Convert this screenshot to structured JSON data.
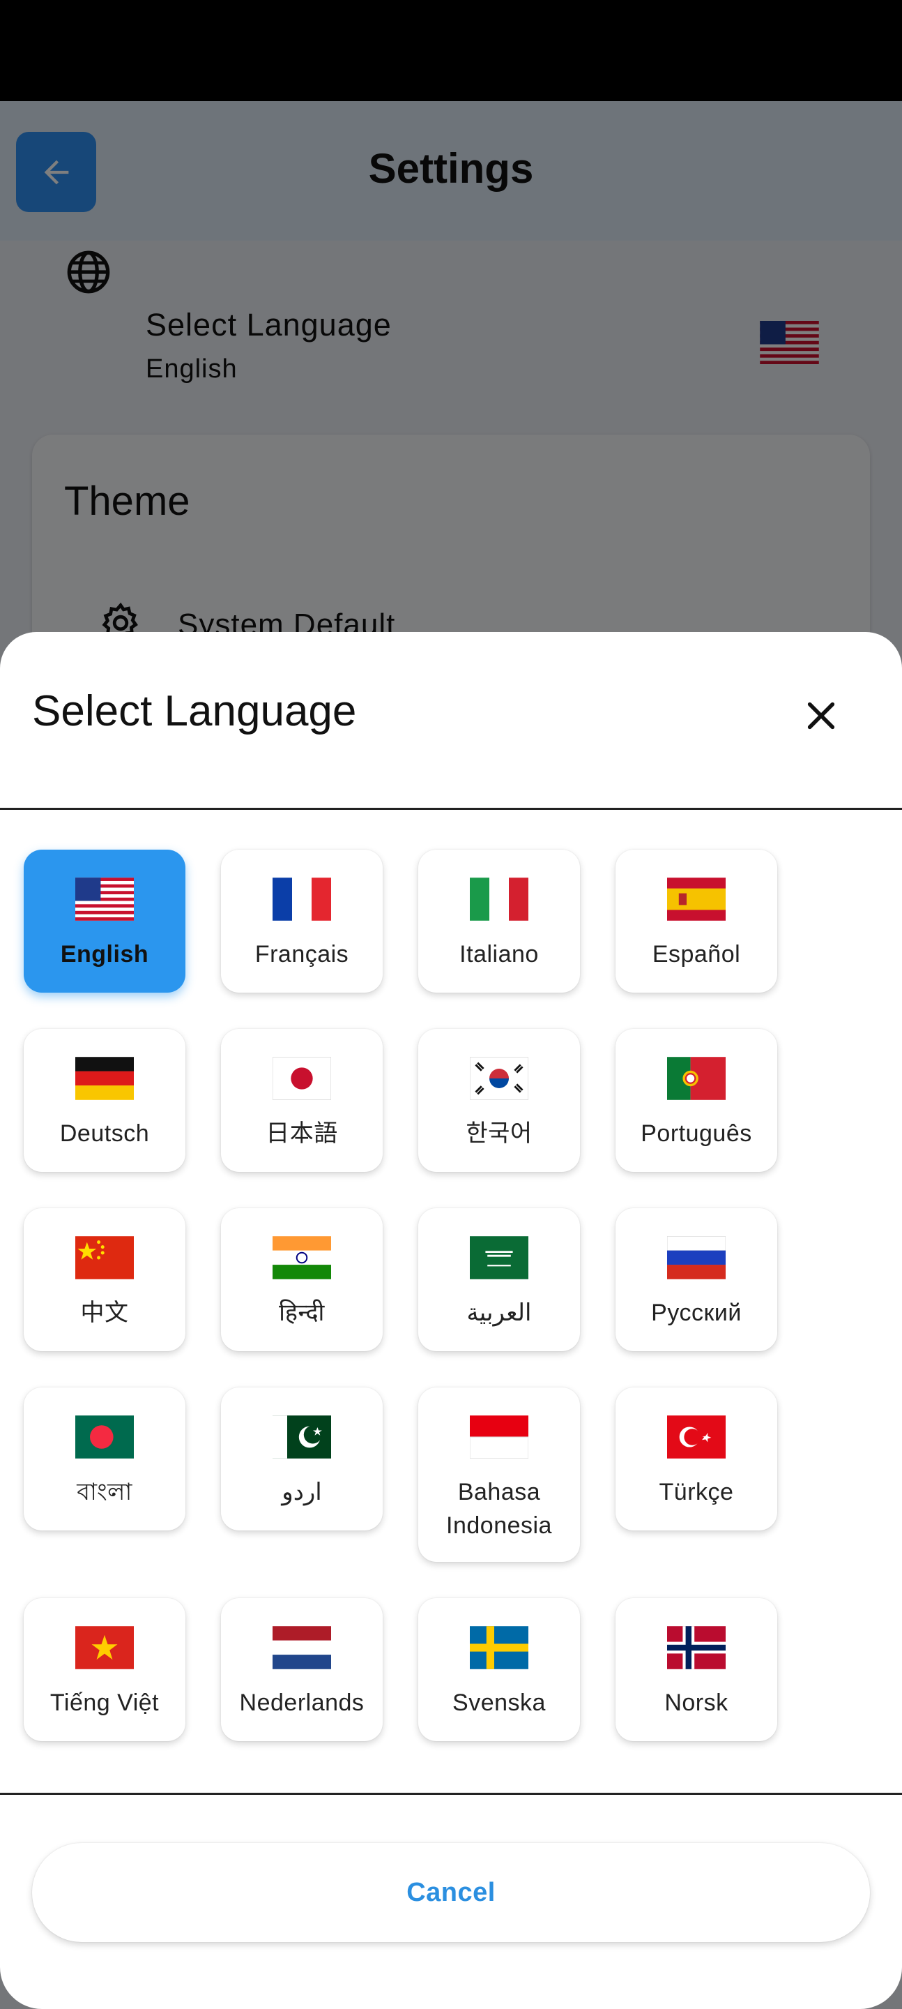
{
  "screen": {
    "title": "Settings",
    "language_setting": {
      "title": "Select Language",
      "value": "English",
      "flag_icon": "us-flag"
    },
    "theme": {
      "title": "Theme",
      "option": "System Default"
    }
  },
  "dialog": {
    "title": "Select Language",
    "cancel_label": "Cancel",
    "accent_color": "#2b96ee",
    "languages": [
      {
        "label": "English",
        "flag": "us-flag",
        "selected": true
      },
      {
        "label": "Français",
        "flag": "france-flag"
      },
      {
        "label": "Italiano",
        "flag": "italy-flag"
      },
      {
        "label": "Español",
        "flag": "spain-flag"
      },
      {
        "label": "Deutsch",
        "flag": "germany-flag"
      },
      {
        "label": "日本語",
        "flag": "japan-flag"
      },
      {
        "label": "한국어",
        "flag": "korea-flag"
      },
      {
        "label": "Português",
        "flag": "portugal-flag"
      },
      {
        "label": "中文",
        "flag": "china-flag"
      },
      {
        "label": "हिन्दी",
        "flag": "india-flag"
      },
      {
        "label": "العربية",
        "flag": "saudi-arabia-flag"
      },
      {
        "label": "Русский",
        "flag": "russia-flag"
      },
      {
        "label": "বাংলা",
        "flag": "bangladesh-flag"
      },
      {
        "label": "اردو",
        "flag": "pakistan-flag"
      },
      {
        "label": "Bahasa Indonesia",
        "flag": "indonesia-flag"
      },
      {
        "label": "Türkçe",
        "flag": "turkey-flag"
      },
      {
        "label": "Tiếng Việt",
        "flag": "vietnam-flag"
      },
      {
        "label": "Nederlands",
        "flag": "netherlands-flag"
      },
      {
        "label": "Svenska",
        "flag": "sweden-flag"
      },
      {
        "label": "Norsk",
        "flag": "norway-flag"
      }
    ]
  }
}
